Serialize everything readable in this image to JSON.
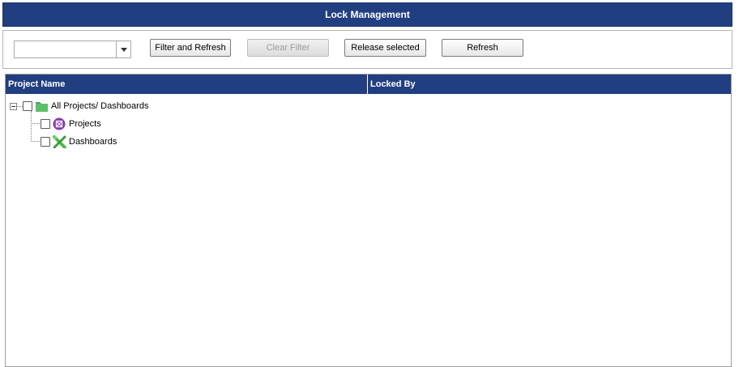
{
  "window": {
    "title": "Lock Management"
  },
  "toolbar": {
    "filter_combo": {
      "value": ""
    },
    "filter_refresh_label": "Filter and Refresh",
    "clear_filter_label": "Clear Filter",
    "release_selected_label": "Release selected",
    "refresh_label": "Refresh"
  },
  "grid": {
    "columns": [
      "Project Name",
      "Locked By"
    ],
    "tree": {
      "root": {
        "label": "All Projects/ Dashboards",
        "icon": "folder-icon",
        "expanded": true,
        "checked": false
      },
      "children": [
        {
          "label": "Projects",
          "icon": "projects-icon",
          "checked": false
        },
        {
          "label": "Dashboards",
          "icon": "dashboards-icon",
          "checked": false
        }
      ]
    }
  },
  "colors": {
    "header_bg": "#213f80",
    "folder": "#5cbf6b",
    "projects_icon": "#8a3aa8",
    "dashboards_icon": "#4fb84a"
  }
}
